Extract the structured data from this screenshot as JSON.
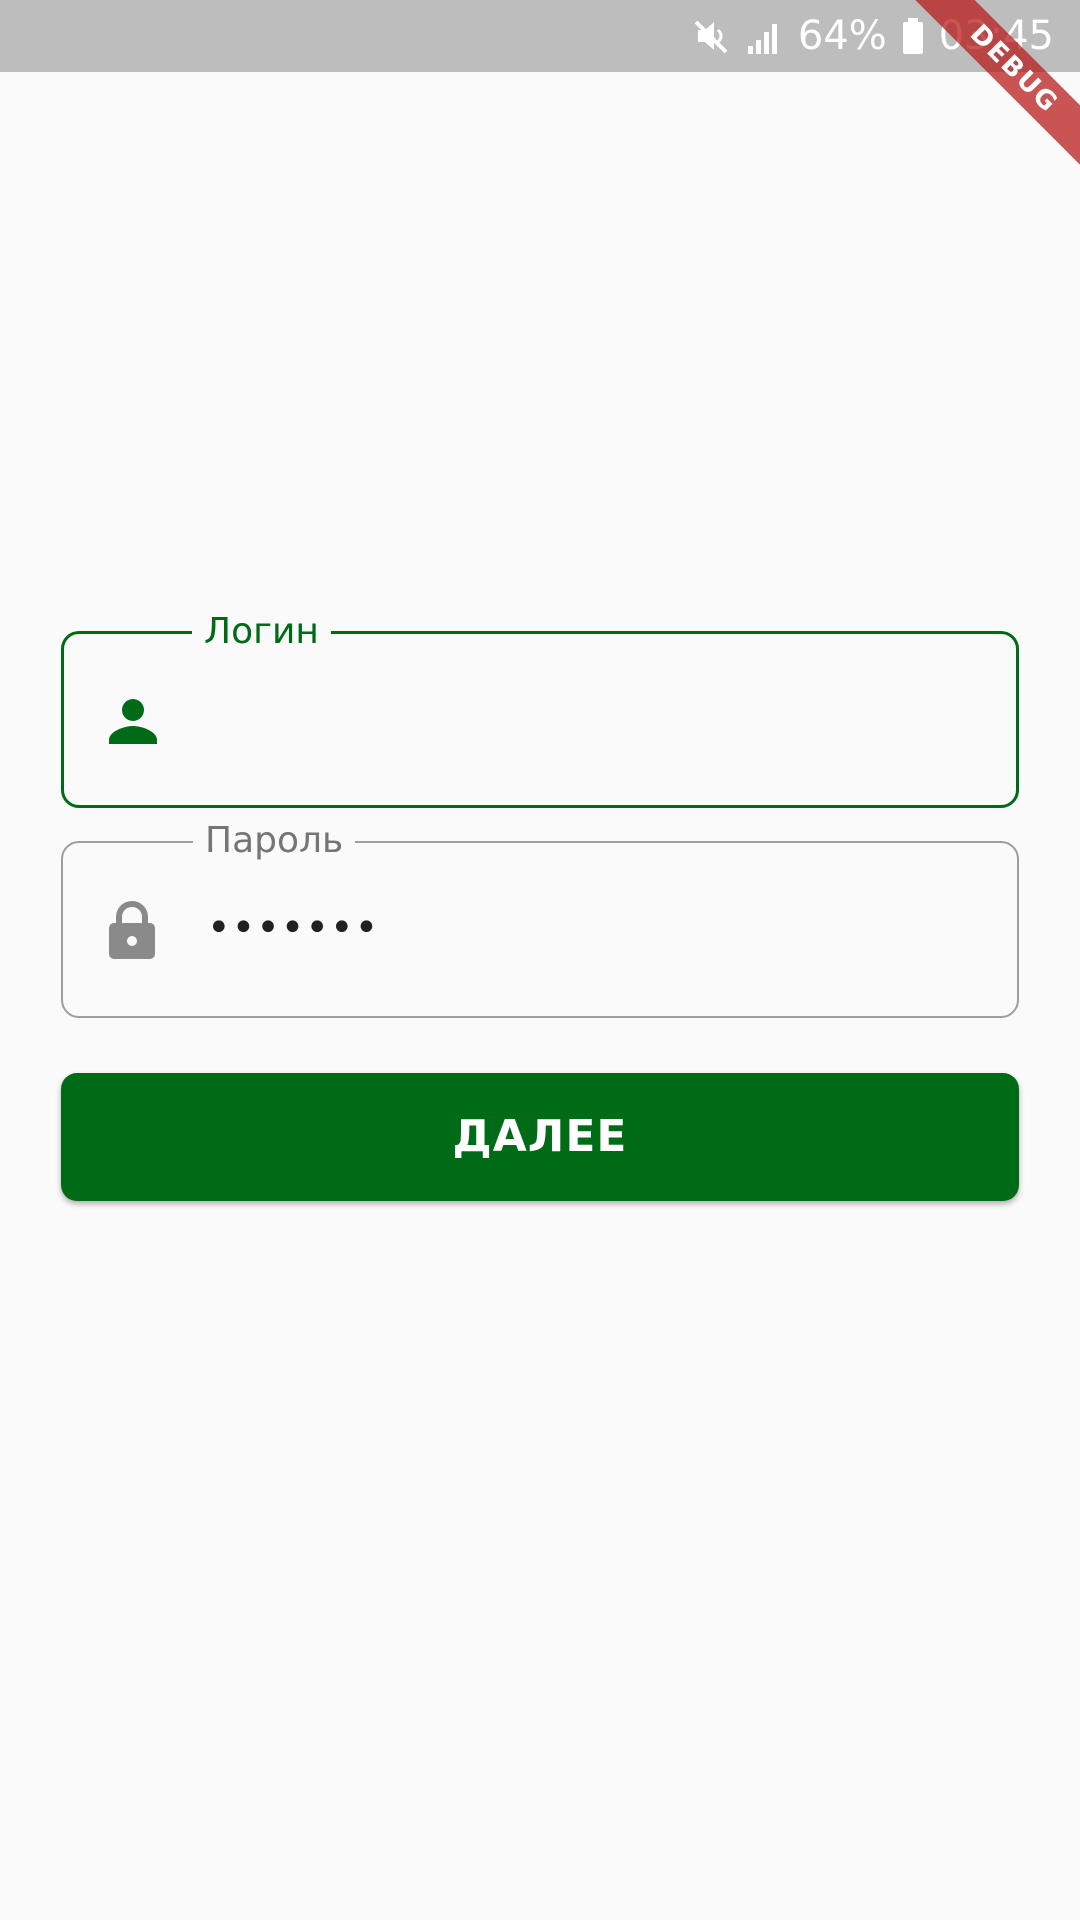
{
  "status_bar": {
    "battery": "64%",
    "time": "03:45",
    "icons": [
      "mute-icon",
      "signal-icon",
      "battery-icon"
    ]
  },
  "debug_banner": "DEBUG",
  "login_form": {
    "login_label": "Логин",
    "login_value": "",
    "login_icon": "person-icon",
    "password_label": "Пароль",
    "password_value": "•••••••",
    "password_icon": "lock-icon",
    "submit_label": "ДАЛЕЕ"
  },
  "colors": {
    "primary": "#006b16",
    "status_bar": "#bdbdbd",
    "background": "#fafafa",
    "inactive_border": "#9e9e9e"
  }
}
